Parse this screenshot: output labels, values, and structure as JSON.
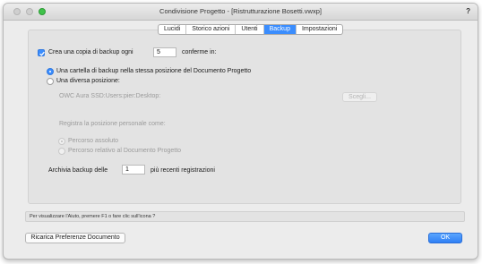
{
  "window": {
    "title": "Condivisione Progetto - [Ristrutturazione Bosetti.vwxp]",
    "help_label": "?"
  },
  "tabs": [
    {
      "label": "Lucidi",
      "active": false
    },
    {
      "label": "Storico azioni",
      "active": false
    },
    {
      "label": "Utenti",
      "active": false
    },
    {
      "label": "Backup",
      "active": true
    },
    {
      "label": "Impostazioni",
      "active": false
    }
  ],
  "backup": {
    "checkbox_label": "Crea una copia di backup ogni",
    "checked": true,
    "interval_value": "5",
    "interval_suffix": "conferme in:",
    "option_same_folder": "Una cartella di backup nella stessa posizione del Documento Progetto",
    "option_other_location": "Una diversa posizione:",
    "selected_option": "same_folder",
    "path": "OWC Aura SSD:Users:pier:Desktop:",
    "choose_button": "Scegli...",
    "register_label": "Registra la posizione personale come:",
    "absolute_path": "Percorso assoluto",
    "relative_path": "Percorso relativo al Documento Progetto",
    "archive_label": "Archivia backup delle",
    "archive_value": "1",
    "archive_suffix": "più recenti registrazioni"
  },
  "status": {
    "help_text": "Per visualizzare l'Aiuto, premere F1 o fare clic sull'icona ?"
  },
  "footer": {
    "reload_button": "Ricarica Preferenze Documento",
    "ok_button": "OK"
  },
  "colors": {
    "accent": "#3b8dfd",
    "window_bg": "#ececec",
    "panel_bg": "#e3e3e3",
    "zoom_green": "#3fc24a"
  }
}
